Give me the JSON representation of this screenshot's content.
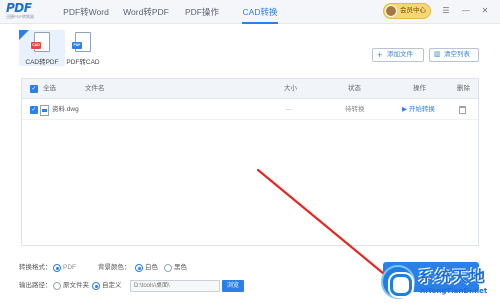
{
  "app": {
    "logo_text": "PDF",
    "logo_subtitle": "迅捷PDF转换器"
  },
  "main_tabs": [
    {
      "label": "PDF转Word",
      "active": false
    },
    {
      "label": "Word转PDF",
      "active": false
    },
    {
      "label": "PDF操作",
      "active": false
    },
    {
      "label": "CAD转换",
      "active": true
    }
  ],
  "header": {
    "vip_label": "会员中心",
    "window_controls": [
      "menu",
      "minimize",
      "close"
    ]
  },
  "sub_tools": [
    {
      "label": "CAD转PDF",
      "active": true,
      "tag": "CAD"
    },
    {
      "label": "PDF转CAD",
      "active": false,
      "tag": "PDF"
    }
  ],
  "toolbar": {
    "add_file_label": "添加文件",
    "clear_list_label": "清空列表"
  },
  "table": {
    "headers": {
      "select_all": "全选",
      "file_name": "文件名",
      "size": "大小",
      "status": "状态",
      "action": "操作",
      "delete": "删除"
    },
    "rows": [
      {
        "checked": true,
        "file_name": "资料.dwg",
        "size": "---",
        "status": "待转换",
        "action": "开始转换"
      }
    ]
  },
  "settings": {
    "format_label": "转换格式：",
    "format_option": "PDF",
    "bg_label": "背景颜色：",
    "bg_options": [
      "白色",
      "黑色"
    ],
    "bg_selected": "白色",
    "output_label": "输出路径：",
    "output_options": [
      "原文件夹",
      "自定义"
    ],
    "output_selected": "自定义",
    "output_path": "D:\\tools\\桌面\\",
    "browse_label": "浏览"
  },
  "watermark": {
    "title": "系统天地",
    "url": "XiTongTianDi.net"
  },
  "colors": {
    "accent": "#2a7fe8",
    "arrow": "#e8261f"
  }
}
